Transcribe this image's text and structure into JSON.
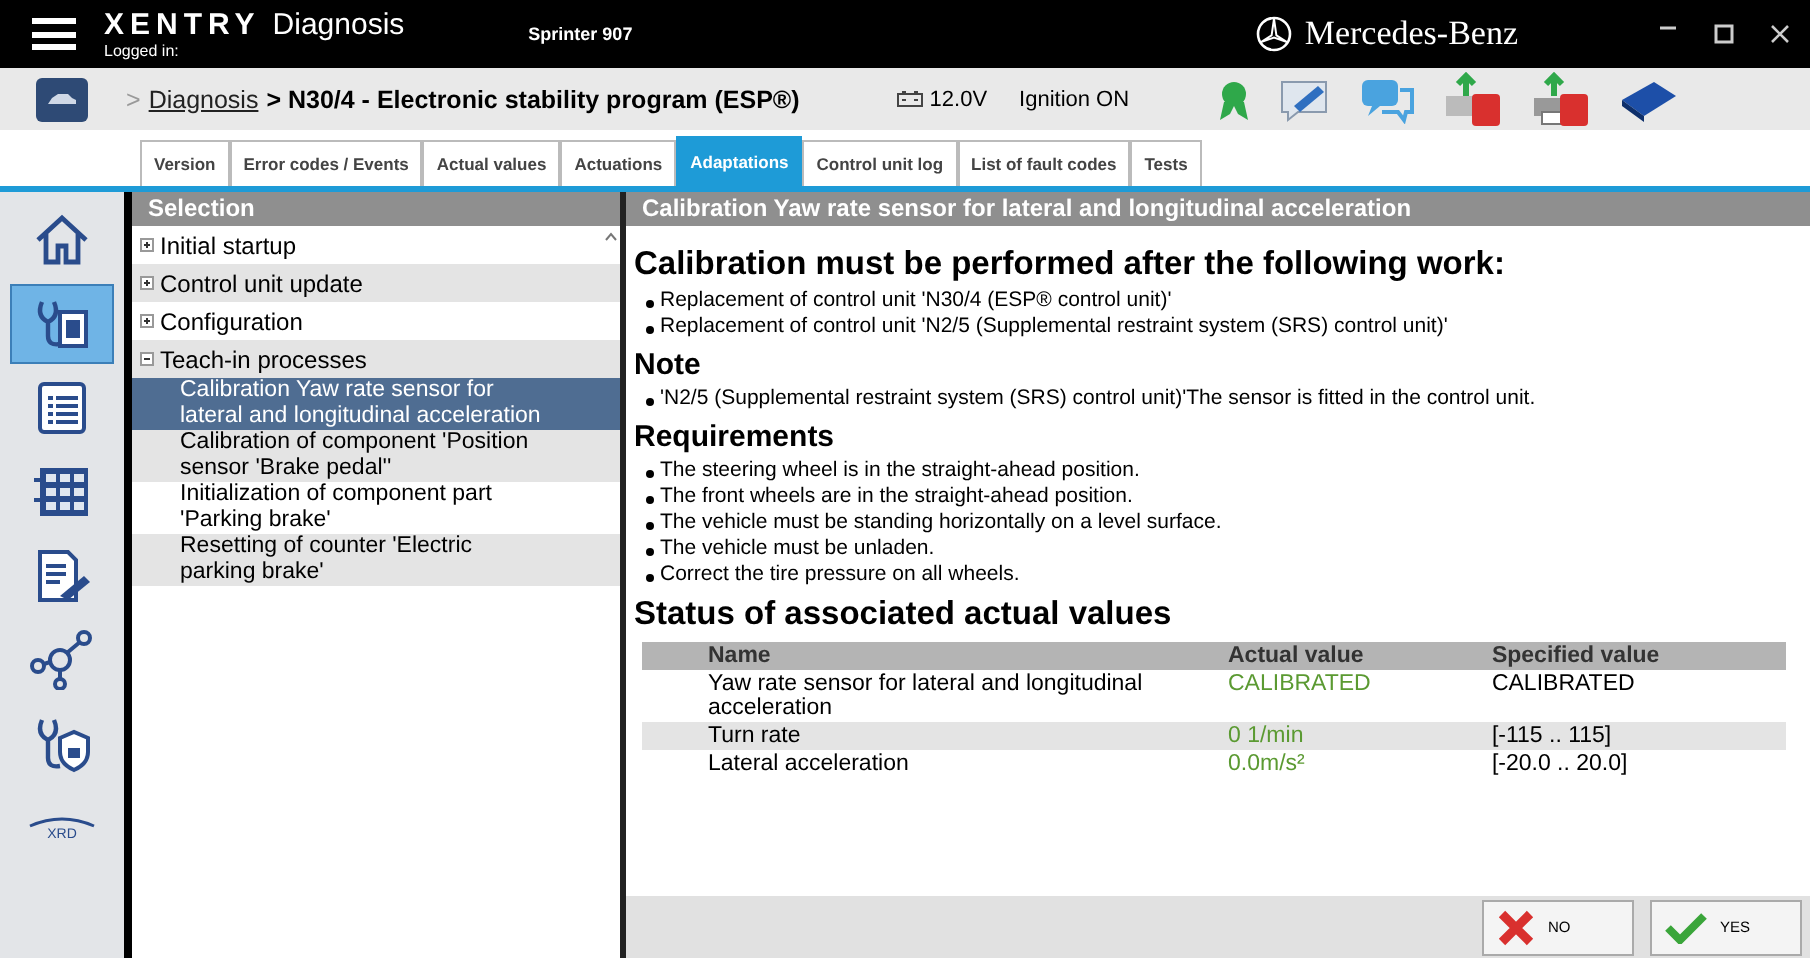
{
  "window": {
    "app_brand": "XENTRY",
    "app_name": "Diagnosis",
    "user": "Logged in:",
    "vehicle": "Sprinter 907",
    "logo_text": "Mercedes-Benz"
  },
  "header": {
    "breadcrumb_prefix": ">",
    "breadcrumb_link": "Diagnosis",
    "breadcrumb_current": "> N30/4 - Electronic stability program (ESP®)",
    "voltage": "12.0V",
    "ignition": "Ignition ON"
  },
  "tabs": [
    {
      "label": "Version",
      "selected": false
    },
    {
      "label": "Error codes / Events",
      "selected": false
    },
    {
      "label": "Actual values",
      "selected": false
    },
    {
      "label": "Actuations",
      "selected": false
    },
    {
      "label": "Adaptations",
      "selected": true
    },
    {
      "label": "Control unit log",
      "selected": false
    },
    {
      "label": "List of fault codes",
      "selected": false
    },
    {
      "label": "Tests",
      "selected": false
    }
  ],
  "rail": [
    {
      "kind": "home",
      "selected": false
    },
    {
      "kind": "diagnosis",
      "selected": true
    },
    {
      "kind": "list",
      "selected": false
    },
    {
      "kind": "grid",
      "selected": false
    },
    {
      "kind": "document",
      "selected": false
    },
    {
      "kind": "network",
      "selected": false
    },
    {
      "kind": "secure",
      "selected": false
    },
    {
      "kind": "xrd",
      "label": "XRD",
      "selected": false
    }
  ],
  "selection": {
    "title": "Selection",
    "items": [
      {
        "label": "Initial startup",
        "expanded": false,
        "selected": false
      },
      {
        "label": "Control unit update",
        "expanded": false,
        "selected": false
      },
      {
        "label": "Configuration",
        "expanded": false,
        "selected": false
      },
      {
        "label": "Teach-in processes",
        "expanded": true,
        "selected": false,
        "children": [
          {
            "label": "Calibration Yaw rate sensor for lateral and longitudinal acceleration",
            "selected": true
          },
          {
            "label": "Calibration of component 'Position sensor 'Brake pedal''",
            "selected": false
          },
          {
            "label": "Initialization of component part 'Parking brake'",
            "selected": false
          },
          {
            "label": "Resetting of counter 'Electric parking brake'",
            "selected": false
          }
        ]
      }
    ]
  },
  "detail": {
    "title": "Calibration Yaw rate sensor for lateral and longitudinal acceleration",
    "sections": [
      {
        "heading": "Calibration must be performed after the following work:",
        "kind": "title",
        "bullets": [
          "Replacement of control unit 'N30/4 (ESP® control unit)'",
          "Replacement of control unit 'N2/5 (Supplemental restraint system (SRS) control unit)'"
        ]
      },
      {
        "heading": "Note",
        "kind": "subtitle",
        "bullets": [
          "'N2/5 (Supplemental restraint system (SRS) control unit)'The sensor is fitted in the control unit."
        ]
      },
      {
        "heading": "Requirements",
        "kind": "subtitle",
        "bullets": [
          "The steering wheel is in the straight-ahead position.",
          "The front wheels are in the straight-ahead position.",
          "The vehicle must be standing horizontally on a level surface.",
          "The vehicle must be unladen.",
          "Correct the tire pressure on all wheels."
        ]
      },
      {
        "heading": "Status of associated actual values",
        "kind": "title"
      }
    ],
    "table": {
      "columns": [
        "Name",
        "Actual value",
        "Specified value"
      ],
      "rows": [
        {
          "name": "Yaw rate sensor for lateral and longitudinal acceleration",
          "actual": "CALIBRATED",
          "specified": "CALIBRATED"
        },
        {
          "name": "Turn rate",
          "actual": "0 1/min",
          "specified": "[-115 .. 115]"
        },
        {
          "name": "Lateral acceleration",
          "actual": "0.0m/s²",
          "specified": "[-20.0 .. 20.0]"
        }
      ]
    }
  },
  "buttons": [
    {
      "kind": "no",
      "label": "NO"
    },
    {
      "kind": "yes",
      "label": "YES"
    }
  ]
}
